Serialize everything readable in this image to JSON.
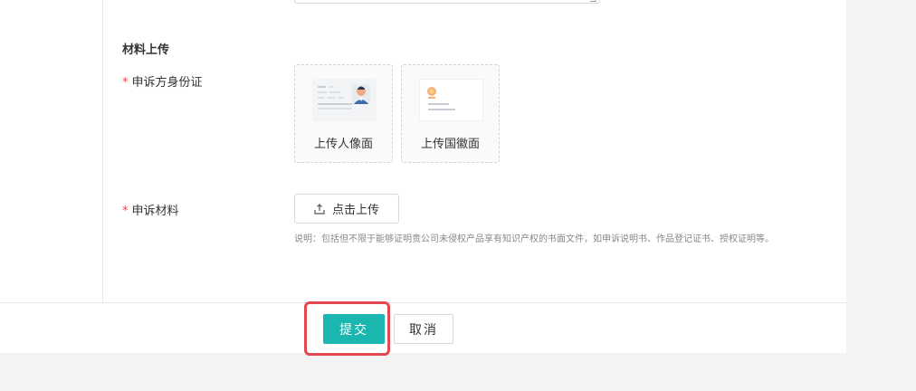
{
  "section": {
    "title": "材料上传"
  },
  "identity": {
    "required_mark": "*",
    "label": "申诉方身份证",
    "cards": [
      {
        "caption": "上传人像面",
        "icon": "id-card-portrait-icon"
      },
      {
        "caption": "上传国徽面",
        "icon": "id-card-emblem-icon"
      }
    ]
  },
  "materials": {
    "required_mark": "*",
    "label": "申诉材料",
    "upload_label": "点击上传",
    "upload_icon": "upload-icon",
    "hint": "说明：包括但不限于能够证明贵公司未侵权产品享有知识产权的书面文件，如申诉说明书、作品登记证书、授权证明等。"
  },
  "footer": {
    "submit_label": "提交",
    "cancel_label": "取消"
  },
  "colors": {
    "accent": "#1bb6b0",
    "required": "#e8474a",
    "highlight": "#e3474f",
    "page_bg": "#f2f3f5"
  }
}
